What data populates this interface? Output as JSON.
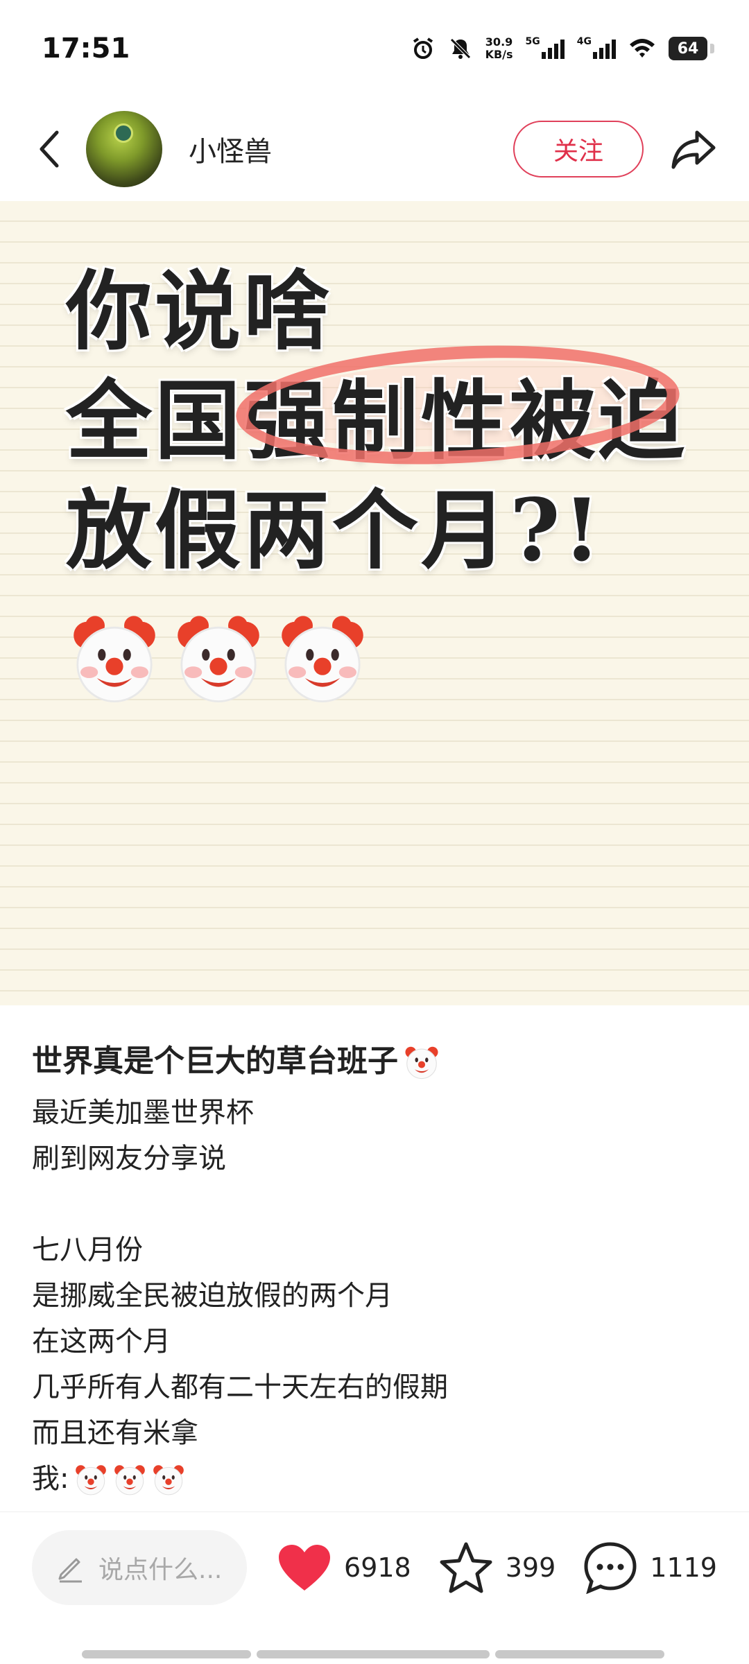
{
  "status_bar": {
    "time": "17:51",
    "net_speed_value": "30.9",
    "net_speed_unit": "KB/s",
    "sim1_label": "5G",
    "sim2_label": "4G",
    "battery": "64",
    "icons": [
      "alarm-icon",
      "mute-icon",
      "signal-icon",
      "wifi-icon",
      "battery-icon"
    ]
  },
  "header": {
    "back_icon": "chevron-left-icon",
    "username": "小怪兽",
    "follow_label": "关注",
    "share_icon": "share-icon"
  },
  "cover": {
    "line1": "你说啥",
    "line2": "全国强制性被迫",
    "line3": "放假两个月?!",
    "emoji": [
      "clown-emoji",
      "clown-emoji",
      "clown-emoji"
    ],
    "highlight_color": "#f07068",
    "background_color": "#faf6e8"
  },
  "post": {
    "title": "世界真是个巨大的草台班子",
    "body": [
      "最近美加墨世界杯",
      "刷到网友分享说",
      "",
      "七八月份",
      "是挪威全民被迫放假的两个月",
      "在这两个月",
      "几乎所有人都有二十天左右的假期",
      "而且还有米拿",
      "我:"
    ]
  },
  "bottom_bar": {
    "comment_placeholder": "说点什么...",
    "likes": "6918",
    "favorites": "399",
    "comments": "1119",
    "like_color": "#f0304a"
  }
}
